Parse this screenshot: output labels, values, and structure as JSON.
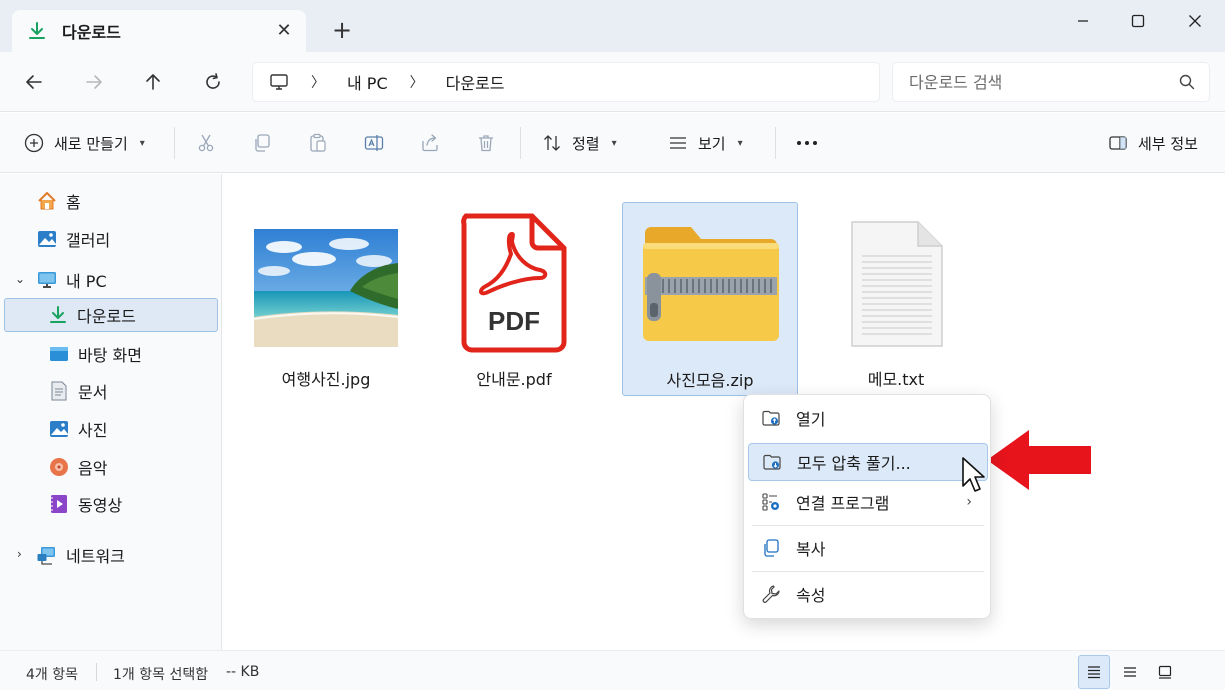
{
  "tab": {
    "title": "다운로드"
  },
  "address": {
    "segments": [
      "내 PC",
      "다운로드"
    ]
  },
  "search": {
    "placeholder": "다운로드 검색"
  },
  "toolbar": {
    "new_label": "새로 만들기",
    "sort_label": "정렬",
    "view_label": "보기",
    "details_label": "세부 정보"
  },
  "sidebar": {
    "items": [
      {
        "label": "홈",
        "icon": "home-icon"
      },
      {
        "label": "갤러리",
        "icon": "gallery-icon"
      },
      {
        "label": "내 PC",
        "icon": "pc-icon"
      },
      {
        "label": "다운로드",
        "icon": "download-icon"
      },
      {
        "label": "바탕 화면",
        "icon": "desktop-icon"
      },
      {
        "label": "문서",
        "icon": "document-icon"
      },
      {
        "label": "사진",
        "icon": "pictures-icon"
      },
      {
        "label": "음악",
        "icon": "music-icon"
      },
      {
        "label": "동영상",
        "icon": "video-icon"
      },
      {
        "label": "네트워크",
        "icon": "network-icon"
      }
    ]
  },
  "files": [
    {
      "name": "여행사진.jpg",
      "icon": "image-thumbnail"
    },
    {
      "name": "안내문.pdf",
      "icon": "pdf-icon",
      "badge": "PDF"
    },
    {
      "name": "사진모음.zip",
      "icon": "zip-folder-icon"
    },
    {
      "name": "메모.txt",
      "icon": "text-file-icon"
    }
  ],
  "context_menu": {
    "items": [
      {
        "label": "열기",
        "icon": "open-icon"
      },
      {
        "label": "모두 압축 풀기...",
        "icon": "extract-icon"
      },
      {
        "label": "연결 프로그램",
        "icon": "open-with-icon"
      },
      {
        "label": "복사",
        "icon": "copy-icon"
      },
      {
        "label": "속성",
        "icon": "properties-icon"
      }
    ]
  },
  "status": {
    "count": "4개 항목",
    "selected": "1개 항목 선택함",
    "size": "-- KB"
  },
  "colors": {
    "accent": "#0067c0",
    "selection": "#dce9f8",
    "arrow": "#e8141b",
    "pdf_red": "#e1251b",
    "download_green": "#1aa260"
  }
}
